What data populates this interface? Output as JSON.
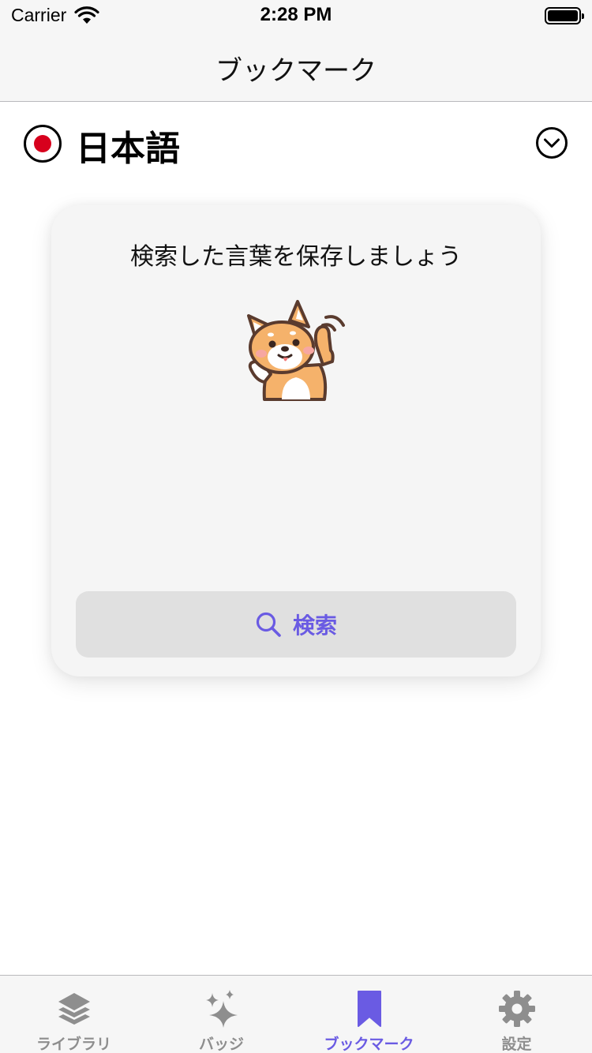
{
  "status_bar": {
    "carrier": "Carrier",
    "time": "2:28 PM"
  },
  "nav": {
    "title": "ブックマーク"
  },
  "language": {
    "name": "日本語",
    "flag_icon": "japan-flag-icon",
    "toggle_icon": "chevron-down-circle-icon"
  },
  "card": {
    "message": "検索した言葉を保存しましょう",
    "illustration": "shiba-dog-waving-icon",
    "search_button_label": "検索",
    "search_icon": "search-icon"
  },
  "tab_bar": {
    "items": [
      {
        "label": "ライブラリ",
        "icon": "layers-icon",
        "active": false
      },
      {
        "label": "バッジ",
        "icon": "sparkles-icon",
        "active": false
      },
      {
        "label": "ブックマーク",
        "icon": "bookmark-icon",
        "active": true
      },
      {
        "label": "設定",
        "icon": "gear-icon",
        "active": false
      }
    ]
  },
  "colors": {
    "accent": "#6a5be3",
    "inactive": "#8e8e8e",
    "flag_red": "#d7001d",
    "card_bg": "#f5f5f5",
    "button_bg": "#e0e0e0"
  }
}
